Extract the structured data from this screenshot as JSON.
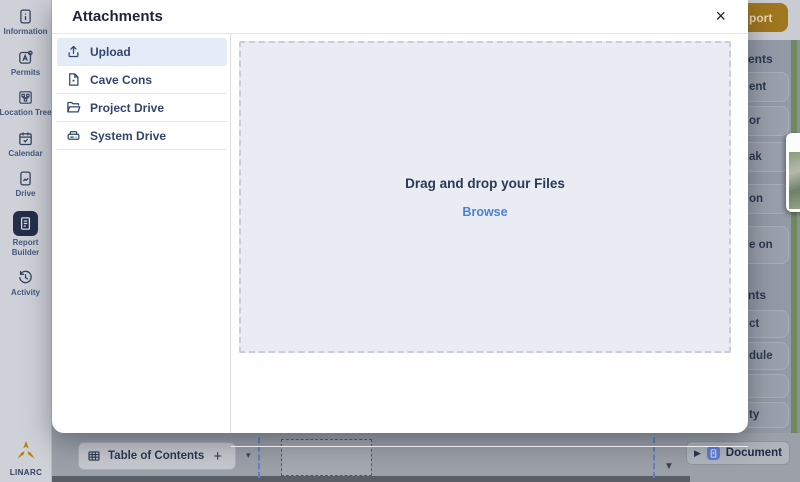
{
  "modal": {
    "title": "Attachments",
    "close_icon": "×",
    "nav": [
      "Upload",
      "Cave Cons",
      "Project Drive",
      "System Drive"
    ],
    "dropzone": {
      "title": "Drag and drop your Files",
      "browse_label": "Browse"
    }
  },
  "sidebar": {
    "items": [
      "Information",
      "Permits",
      "Location Tree",
      "Calendar",
      "Drive",
      "Report Builder",
      "Activity"
    ],
    "logo_text": "LINARC"
  },
  "background": {
    "top_button_fragment": "port",
    "right_panel": {
      "section1_heading": "ents",
      "section1_items": [
        "ent",
        "or",
        "ak",
        "on",
        "e on"
      ],
      "section2_heading": "nts",
      "section2_items": [
        "ct",
        "dule",
        "",
        "ty"
      ]
    },
    "bottom_bar": {
      "toc_label": "Table of Contents",
      "plus_icon": "+",
      "dropdown_icon": "▾",
      "scroll_down_icon": "▼",
      "play_icon": "▶",
      "document_label": "Document"
    }
  },
  "colors": {
    "brand_gold": "#B8860F",
    "accent_button": "#A0761E",
    "link_blue": "#4C80D8",
    "nav_selected_bg": "#E4ECF8",
    "dropzone_bg": "#E9ECF2",
    "green_strip": "#6D8A5F",
    "sidebar_active_bg": "#232F49"
  }
}
